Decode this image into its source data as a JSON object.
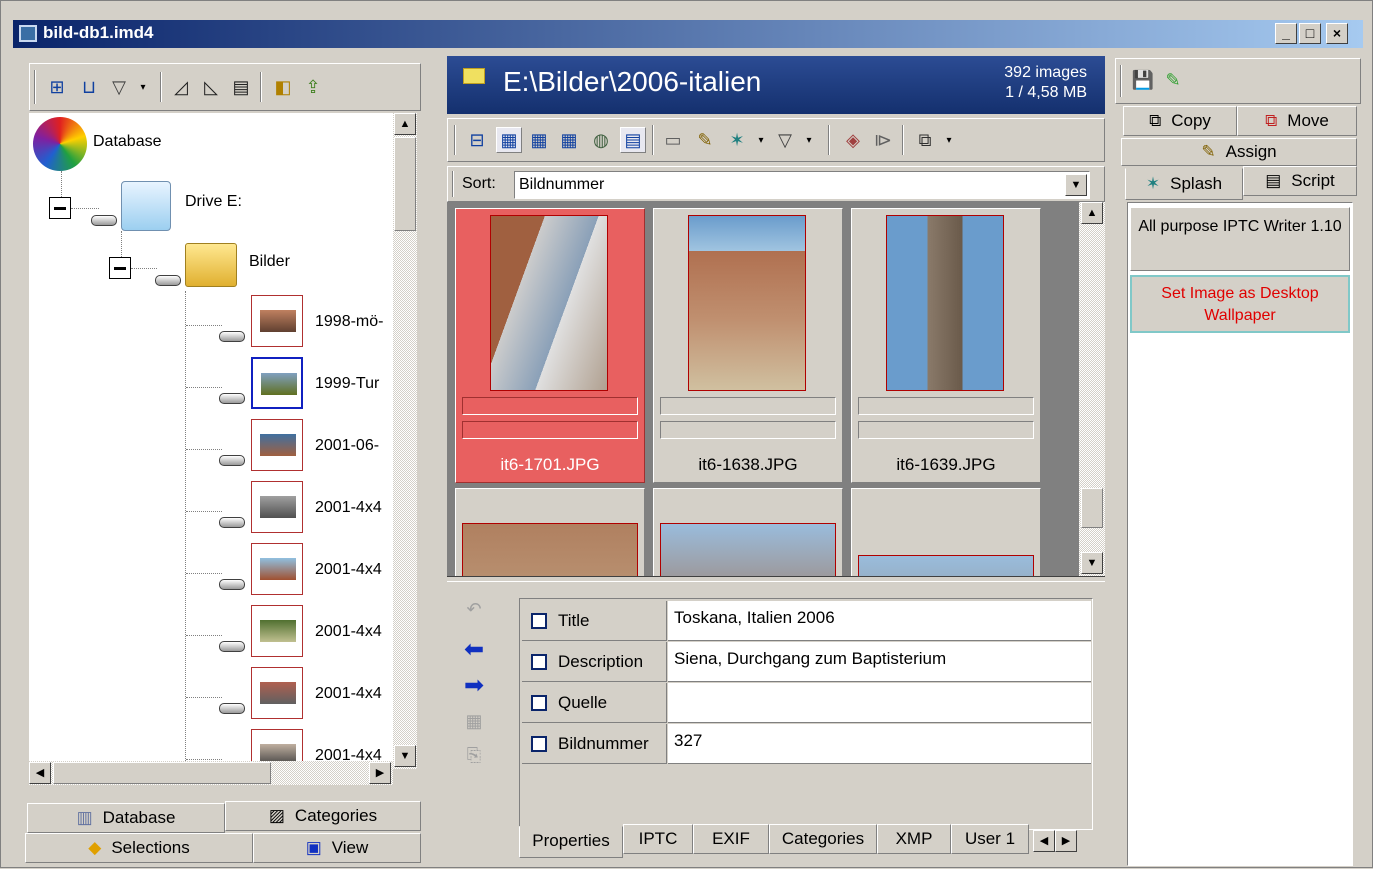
{
  "window": {
    "title": "bild-db1.imd4",
    "min": "_",
    "max": "□",
    "close": "×"
  },
  "tree": {
    "root": "Database",
    "drive": "Drive E:",
    "folder": "Bilder",
    "items": [
      "1998-mö-",
      "1999-Tur",
      "2001-06-",
      "2001-4x4",
      "2001-4x4",
      "2001-4x4",
      "2001-4x4",
      "2001-4x4"
    ]
  },
  "left_tabs": {
    "database": "Database",
    "categories": "Categories",
    "selections": "Selections",
    "view": "View"
  },
  "header": {
    "path": "E:\\Bilder\\2006-italien",
    "count": "392 images",
    "size": "1 / 4,58 MB"
  },
  "sort": {
    "label": "Sort:",
    "value": "Bildnummer"
  },
  "thumbs": [
    {
      "name": "it6-1701.JPG",
      "selected": true
    },
    {
      "name": "it6-1638.JPG",
      "selected": false
    },
    {
      "name": "it6-1639.JPG",
      "selected": false
    }
  ],
  "properties": [
    {
      "field": "Title",
      "value": "Toskana, Italien 2006"
    },
    {
      "field": "Description",
      "value": "Siena, Durchgang zum Baptisterium"
    },
    {
      "field": "Quelle",
      "value": ""
    },
    {
      "field": "Bildnummer",
      "value": "327"
    }
  ],
  "bottom_tabs": [
    "Properties",
    "IPTC",
    "EXIF",
    "Categories",
    "XMP",
    "User 1"
  ],
  "right": {
    "copy": "Copy",
    "move": "Move",
    "assign": "Assign",
    "splash": "Splash",
    "script": "Script",
    "iptc_writer": "All purpose IPTC Writer 1.10",
    "wallpaper": "Set Image as Desktop Wallpaper"
  },
  "colors": {
    "title_from": "#0a246a",
    "title_to": "#a6caf0",
    "selection": "#e86060",
    "header_bg": "#1c3a7a",
    "link_red": "#e00000"
  }
}
